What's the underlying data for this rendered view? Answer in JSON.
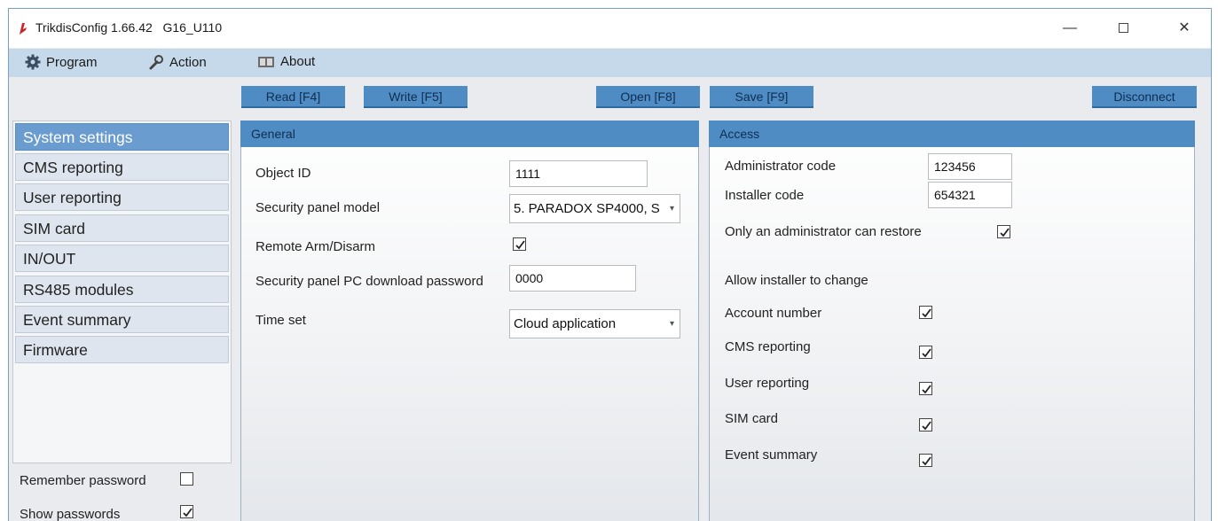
{
  "window": {
    "title": "TrikdisConfig 1.66.42",
    "device": "G16_U110",
    "controls": {
      "minimize": "—",
      "close": "✕"
    }
  },
  "menu": [
    {
      "label": "Program",
      "icon": "gear-icon"
    },
    {
      "label": "Action",
      "icon": "wrench-icon"
    },
    {
      "label": "About",
      "icon": "book-icon"
    }
  ],
  "toolbar": {
    "read": "Read [F4]",
    "write": "Write [F5]",
    "open": "Open [F8]",
    "save": "Save [F9]",
    "disconnect": "Disconnect"
  },
  "sidebar": {
    "items": [
      {
        "label": "System settings",
        "active": true
      },
      {
        "label": "CMS reporting"
      },
      {
        "label": "User reporting"
      },
      {
        "label": "SIM card"
      },
      {
        "label": "IN/OUT"
      },
      {
        "label": "RS485 modules"
      },
      {
        "label": "Event summary"
      },
      {
        "label": "Firmware"
      }
    ],
    "remember_password": {
      "label": "Remember password",
      "checked": false
    },
    "show_passwords": {
      "label": "Show passwords",
      "checked": true
    }
  },
  "general": {
    "title": "General",
    "object_id": {
      "label": "Object ID",
      "value": "1111"
    },
    "panel_model": {
      "label": "Security panel model",
      "value": "5. PARADOX SP4000, S"
    },
    "remote_arm": {
      "label": "Remote Arm/Disarm",
      "checked": true
    },
    "pc_password": {
      "label": "Security panel PC download password",
      "value": "0000"
    },
    "time_set": {
      "label": "Time set",
      "value": "Cloud application"
    }
  },
  "access": {
    "title": "Access",
    "admin_code": {
      "label": "Administrator code",
      "value": "123456"
    },
    "installer_code": {
      "label": "Installer code",
      "value": "654321"
    },
    "only_admin_restore": {
      "label": "Only an administrator can restore",
      "checked": true
    },
    "allow_installer_heading": "Allow installer to change",
    "allow_items": [
      {
        "label": "Account number",
        "checked": true
      },
      {
        "label": "CMS reporting",
        "checked": true
      },
      {
        "label": "User reporting",
        "checked": true
      },
      {
        "label": "SIM card",
        "checked": true
      },
      {
        "label": "Event summary",
        "checked": true
      }
    ]
  },
  "colors": {
    "accent": "#4f8cc4",
    "menubar": "#c6d9ea",
    "nav_active": "#6a9cd0",
    "nav_item": "#dfe5ee"
  }
}
